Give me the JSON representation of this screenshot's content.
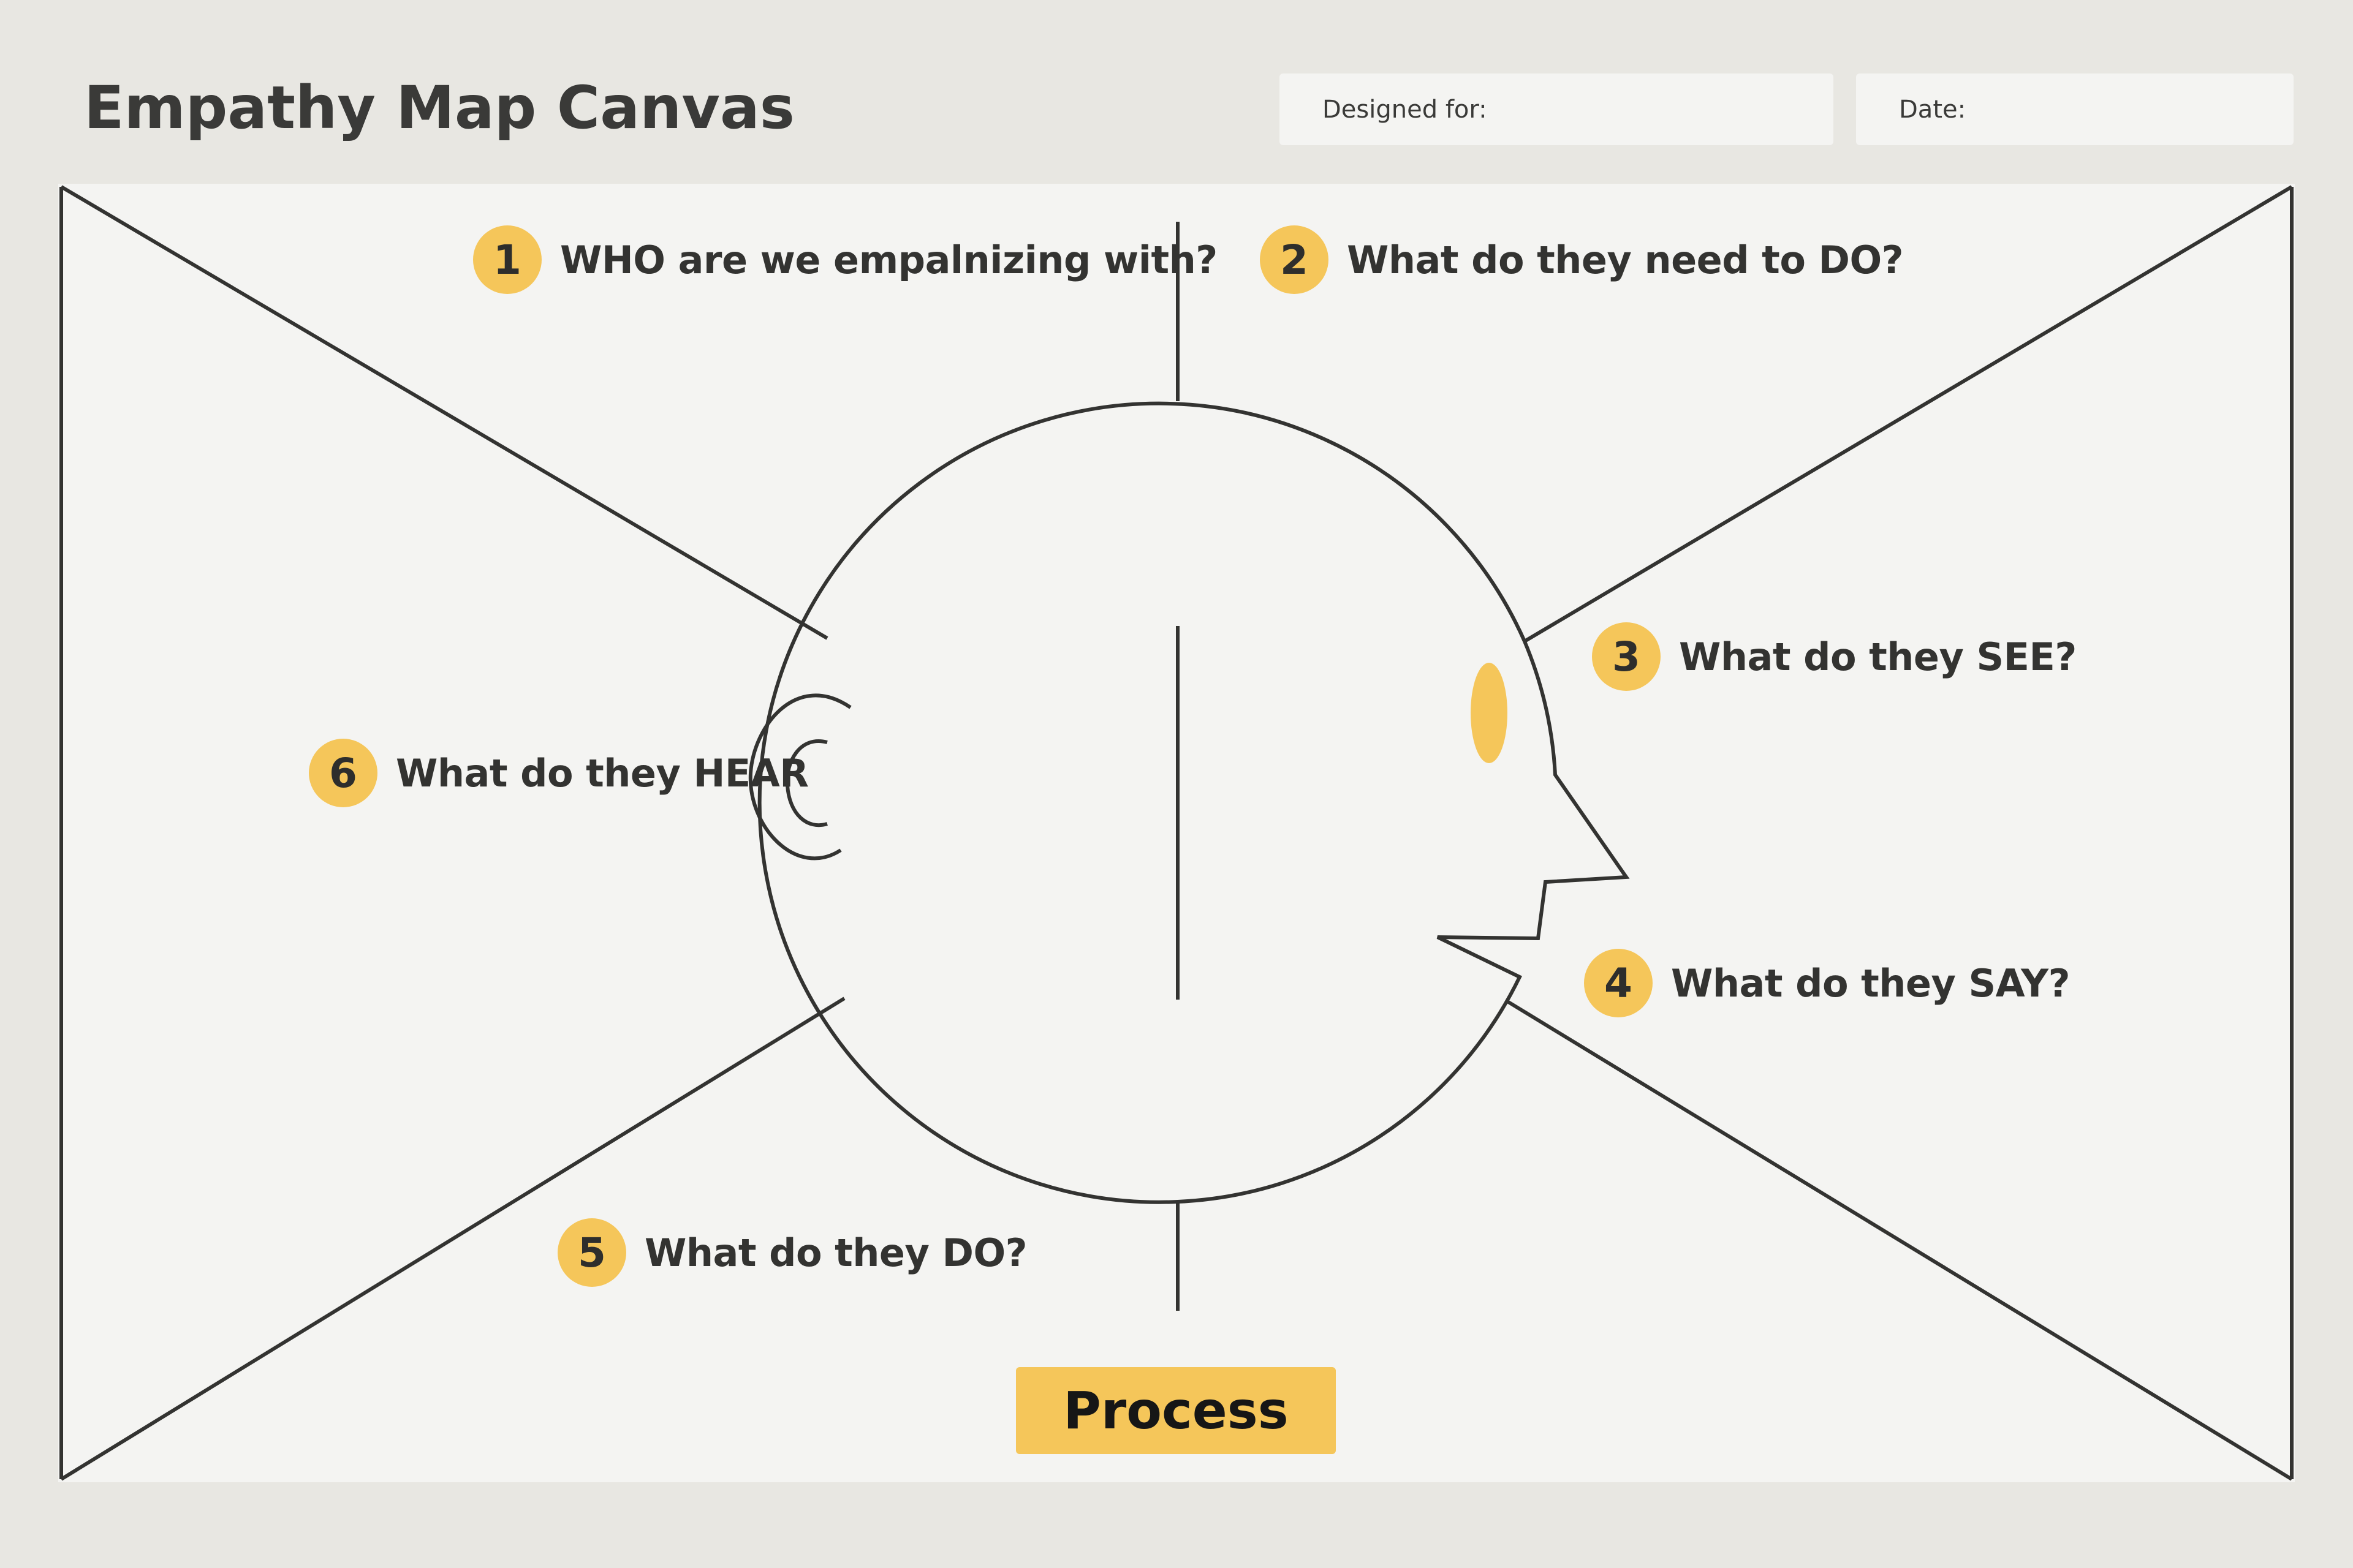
{
  "header": {
    "title": "Empathy Map Canvas",
    "designed_for_label": "Designed for:",
    "date_label": "Date:"
  },
  "sections": [
    {
      "number": "1",
      "question": "WHO are we empalnizing with?"
    },
    {
      "number": "2",
      "question": "What do they need to DO?"
    },
    {
      "number": "3",
      "question": "What do they SEE?"
    },
    {
      "number": "4",
      "question": "What do they SAY?"
    },
    {
      "number": "5",
      "question": "What do they DO?"
    },
    {
      "number": "6",
      "question": "What do they HEAR"
    }
  ],
  "actions": {
    "process_label": "Process"
  },
  "colors": {
    "accent": "#f5c65a",
    "line": "#333331",
    "canvas": "#f4f4f2",
    "background": "#e8e7e2"
  }
}
